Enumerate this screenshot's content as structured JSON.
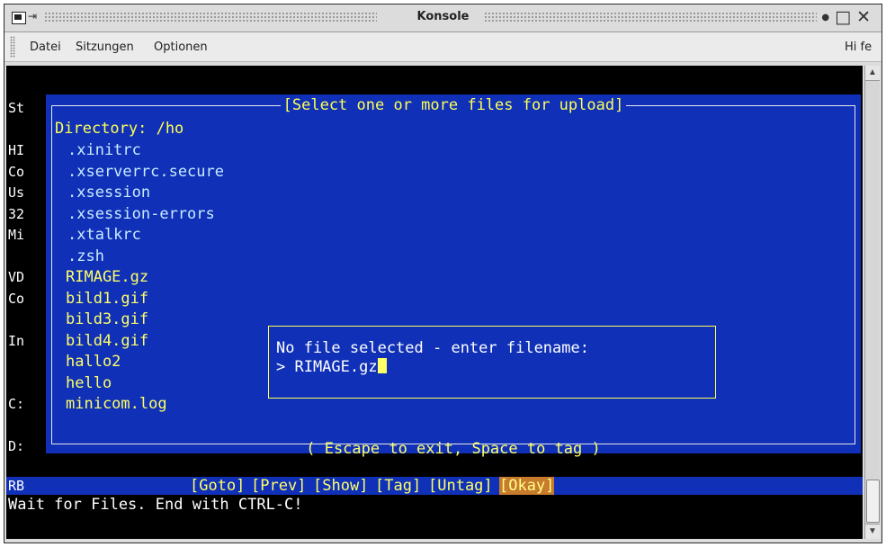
{
  "window": {
    "title": "Konsole"
  },
  "menu": {
    "items": [
      "Datei",
      "Sitzungen",
      "Optionen"
    ],
    "help": "Hi fe"
  },
  "terminal": {
    "left_fragments": [
      {
        "text": "St",
        "row": 0
      },
      {
        "text": "HI",
        "row": 2
      },
      {
        "text": "Co",
        "row": 3
      },
      {
        "text": "Us",
        "row": 4
      },
      {
        "text": "32",
        "row": 5
      },
      {
        "text": "Mi",
        "row": 6
      },
      {
        "text": "VD",
        "row": 8
      },
      {
        "text": "Co",
        "row": 9
      },
      {
        "text": "In",
        "row": 11
      },
      {
        "text": "C:",
        "row": 14
      },
      {
        "text": "D:",
        "row": 16
      }
    ],
    "rb_label": "RB",
    "status_line": "Wait for Files. End with CTRL-C!"
  },
  "dialog": {
    "title": "[Select one or more files for upload]",
    "directory": "Directory: /ho",
    "files": [
      ".xinitrc",
      ".xserverrc.secure",
      ".xsession",
      ".xsession-errors",
      ".xtalkrc",
      ".zsh",
      "RIMAGE.gz",
      "bild1.gif",
      "bild3.gif",
      "bild4.gif",
      "hallo2",
      "hello",
      "minicom.log"
    ],
    "hint": "( Escape to exit, Space to tag )"
  },
  "prompt": {
    "message": "No file selected - enter filename:",
    "input": "> RIMAGE.gz"
  },
  "buttons": {
    "goto": "[Goto]",
    "prev": "[Prev]",
    "show": "[Show]",
    "tag": "[Tag]",
    "untag": "[Untag]",
    "okay": "[Okay]"
  },
  "colors": {
    "dialog_bg": "#0f30b7",
    "highlight": "#ffff55",
    "selected_button": "#c77b2c"
  }
}
